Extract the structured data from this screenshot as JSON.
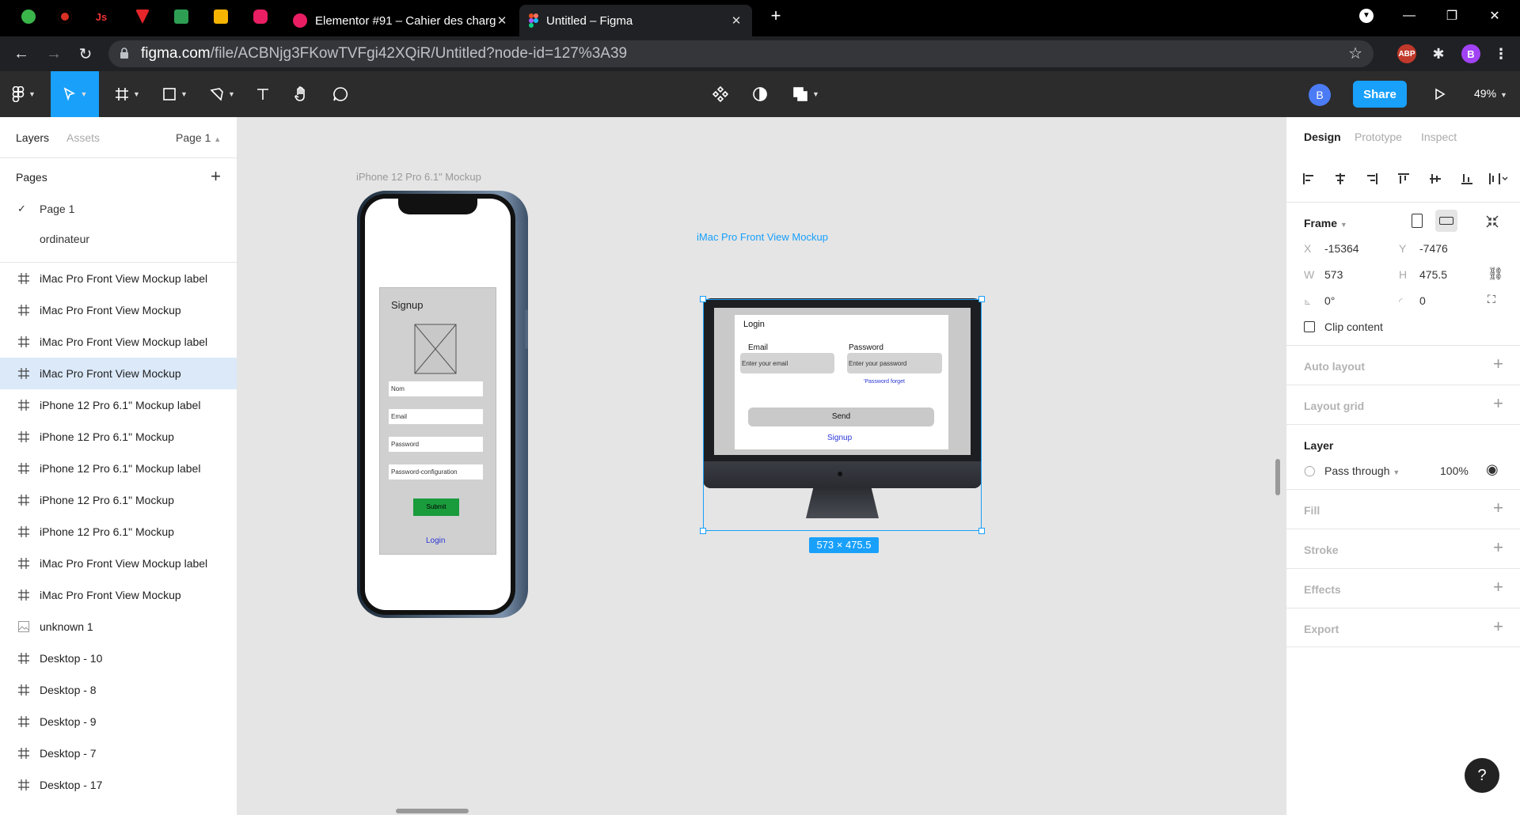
{
  "browser": {
    "tabs": [
      {
        "title": "Elementor #91 – Cahier des charg"
      },
      {
        "title": "Untitled – Figma"
      }
    ],
    "favicon_tabs": [
      "leaf-icon",
      "record-icon",
      "js-icon",
      "v-icon",
      "feather-icon",
      "slides-icon",
      "camera-icon"
    ],
    "url_host": "figma.com",
    "url_path": "/file/ACBNjg3FKowTVFgi42XQiR/Untitled?node-id=127%3A39",
    "ext_abp": "ABP",
    "profile": "B"
  },
  "toolbar": {
    "avatar": "B",
    "share_label": "Share",
    "zoom": "49%"
  },
  "left_panel": {
    "tab_layers": "Layers",
    "tab_assets": "Assets",
    "page_selector": "Page 1",
    "pages_header": "Pages",
    "pages": [
      "Page 1",
      "ordinateur"
    ],
    "layers": [
      {
        "name": "iMac Pro Front View Mockup label",
        "type": "frame"
      },
      {
        "name": "iMac Pro Front View Mockup",
        "type": "frame"
      },
      {
        "name": "iMac Pro Front View Mockup label",
        "type": "frame"
      },
      {
        "name": "iMac Pro Front View Mockup",
        "type": "frame",
        "selected": true
      },
      {
        "name": "iPhone 12 Pro 6.1\" Mockup label",
        "type": "frame"
      },
      {
        "name": "iPhone 12 Pro 6.1\" Mockup",
        "type": "frame"
      },
      {
        "name": "iPhone 12 Pro 6.1\" Mockup label",
        "type": "frame"
      },
      {
        "name": "iPhone 12 Pro 6.1\" Mockup",
        "type": "frame"
      },
      {
        "name": "iPhone 12 Pro 6.1\" Mockup",
        "type": "frame"
      },
      {
        "name": "iMac Pro Front View Mockup label",
        "type": "frame"
      },
      {
        "name": "iMac Pro Front View Mockup",
        "type": "frame"
      },
      {
        "name": "unknown 1",
        "type": "image"
      },
      {
        "name": "Desktop - 10",
        "type": "frame"
      },
      {
        "name": "Desktop - 8",
        "type": "frame"
      },
      {
        "name": "Desktop - 9",
        "type": "frame"
      },
      {
        "name": "Desktop - 7",
        "type": "frame"
      },
      {
        "name": "Desktop - 17",
        "type": "frame"
      }
    ]
  },
  "canvas": {
    "phone_label": "iPhone 12 Pro 6.1\" Mockup",
    "imac_label": "iMac Pro Front View Mockup",
    "size_badge": "573 × 475.5",
    "phone_form": {
      "title": "Signup",
      "fields": [
        "Nom",
        "Email",
        "Password",
        "Password-configuration"
      ],
      "submit": "Submit",
      "link": "Login"
    },
    "imac_form": {
      "title": "Login",
      "email_label": "Email",
      "email_placeholder": "Enter your email",
      "password_label": "Password",
      "password_placeholder": "Enter your password",
      "forgot": "'Password forget",
      "send": "Send",
      "signup": "Signup"
    }
  },
  "right_panel": {
    "tabs": [
      "Design",
      "Prototype",
      "Inspect"
    ],
    "frame_label": "Frame",
    "x_label": "X",
    "x": "-15364",
    "y_label": "Y",
    "y": "-7476",
    "w_label": "W",
    "w": "573",
    "h_label": "H",
    "h": "475.5",
    "rotation": "0°",
    "radius": "0",
    "clip_content": "Clip content",
    "auto_layout": "Auto layout",
    "layout_grid": "Layout grid",
    "layer_header": "Layer",
    "blend": "Pass through",
    "opacity": "100%",
    "fill": "Fill",
    "stroke": "Stroke",
    "effects": "Effects",
    "export": "Export"
  },
  "help": "?",
  "colors": {
    "accent": "#18a0fb",
    "toolbar": "#2c2c2c",
    "selected_layer": "#dbe9f9"
  }
}
